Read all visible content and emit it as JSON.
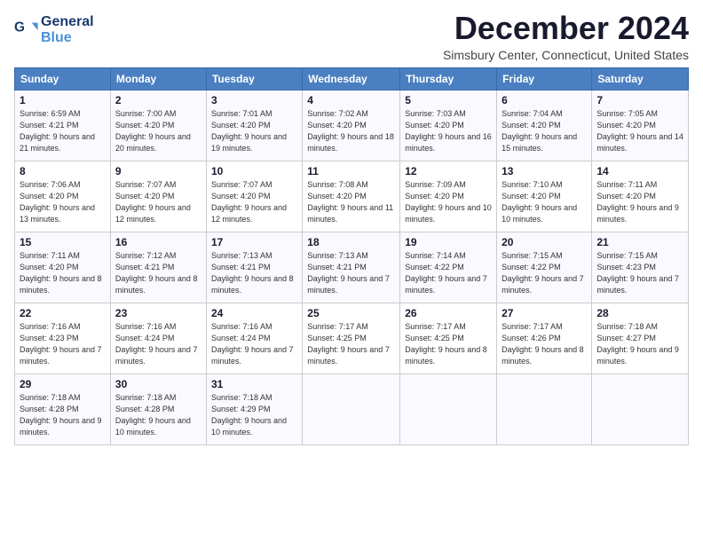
{
  "header": {
    "logo_line1": "General",
    "logo_line2": "Blue",
    "title": "December 2024",
    "subtitle": "Simsbury Center, Connecticut, United States"
  },
  "calendar": {
    "days_of_week": [
      "Sunday",
      "Monday",
      "Tuesday",
      "Wednesday",
      "Thursday",
      "Friday",
      "Saturday"
    ],
    "weeks": [
      [
        {
          "day": "1",
          "sunrise": "6:59 AM",
          "sunset": "4:21 PM",
          "daylight": "9 hours and 21 minutes."
        },
        {
          "day": "2",
          "sunrise": "7:00 AM",
          "sunset": "4:20 PM",
          "daylight": "9 hours and 20 minutes."
        },
        {
          "day": "3",
          "sunrise": "7:01 AM",
          "sunset": "4:20 PM",
          "daylight": "9 hours and 19 minutes."
        },
        {
          "day": "4",
          "sunrise": "7:02 AM",
          "sunset": "4:20 PM",
          "daylight": "9 hours and 18 minutes."
        },
        {
          "day": "5",
          "sunrise": "7:03 AM",
          "sunset": "4:20 PM",
          "daylight": "9 hours and 16 minutes."
        },
        {
          "day": "6",
          "sunrise": "7:04 AM",
          "sunset": "4:20 PM",
          "daylight": "9 hours and 15 minutes."
        },
        {
          "day": "7",
          "sunrise": "7:05 AM",
          "sunset": "4:20 PM",
          "daylight": "9 hours and 14 minutes."
        }
      ],
      [
        {
          "day": "8",
          "sunrise": "7:06 AM",
          "sunset": "4:20 PM",
          "daylight": "9 hours and 13 minutes."
        },
        {
          "day": "9",
          "sunrise": "7:07 AM",
          "sunset": "4:20 PM",
          "daylight": "9 hours and 12 minutes."
        },
        {
          "day": "10",
          "sunrise": "7:07 AM",
          "sunset": "4:20 PM",
          "daylight": "9 hours and 12 minutes."
        },
        {
          "day": "11",
          "sunrise": "7:08 AM",
          "sunset": "4:20 PM",
          "daylight": "9 hours and 11 minutes."
        },
        {
          "day": "12",
          "sunrise": "7:09 AM",
          "sunset": "4:20 PM",
          "daylight": "9 hours and 10 minutes."
        },
        {
          "day": "13",
          "sunrise": "7:10 AM",
          "sunset": "4:20 PM",
          "daylight": "9 hours and 10 minutes."
        },
        {
          "day": "14",
          "sunrise": "7:11 AM",
          "sunset": "4:20 PM",
          "daylight": "9 hours and 9 minutes."
        }
      ],
      [
        {
          "day": "15",
          "sunrise": "7:11 AM",
          "sunset": "4:20 PM",
          "daylight": "9 hours and 8 minutes."
        },
        {
          "day": "16",
          "sunrise": "7:12 AM",
          "sunset": "4:21 PM",
          "daylight": "9 hours and 8 minutes."
        },
        {
          "day": "17",
          "sunrise": "7:13 AM",
          "sunset": "4:21 PM",
          "daylight": "9 hours and 8 minutes."
        },
        {
          "day": "18",
          "sunrise": "7:13 AM",
          "sunset": "4:21 PM",
          "daylight": "9 hours and 7 minutes."
        },
        {
          "day": "19",
          "sunrise": "7:14 AM",
          "sunset": "4:22 PM",
          "daylight": "9 hours and 7 minutes."
        },
        {
          "day": "20",
          "sunrise": "7:15 AM",
          "sunset": "4:22 PM",
          "daylight": "9 hours and 7 minutes."
        },
        {
          "day": "21",
          "sunrise": "7:15 AM",
          "sunset": "4:23 PM",
          "daylight": "9 hours and 7 minutes."
        }
      ],
      [
        {
          "day": "22",
          "sunrise": "7:16 AM",
          "sunset": "4:23 PM",
          "daylight": "9 hours and 7 minutes."
        },
        {
          "day": "23",
          "sunrise": "7:16 AM",
          "sunset": "4:24 PM",
          "daylight": "9 hours and 7 minutes."
        },
        {
          "day": "24",
          "sunrise": "7:16 AM",
          "sunset": "4:24 PM",
          "daylight": "9 hours and 7 minutes."
        },
        {
          "day": "25",
          "sunrise": "7:17 AM",
          "sunset": "4:25 PM",
          "daylight": "9 hours and 7 minutes."
        },
        {
          "day": "26",
          "sunrise": "7:17 AM",
          "sunset": "4:25 PM",
          "daylight": "9 hours and 8 minutes."
        },
        {
          "day": "27",
          "sunrise": "7:17 AM",
          "sunset": "4:26 PM",
          "daylight": "9 hours and 8 minutes."
        },
        {
          "day": "28",
          "sunrise": "7:18 AM",
          "sunset": "4:27 PM",
          "daylight": "9 hours and 9 minutes."
        }
      ],
      [
        {
          "day": "29",
          "sunrise": "7:18 AM",
          "sunset": "4:28 PM",
          "daylight": "9 hours and 9 minutes."
        },
        {
          "day": "30",
          "sunrise": "7:18 AM",
          "sunset": "4:28 PM",
          "daylight": "9 hours and 10 minutes."
        },
        {
          "day": "31",
          "sunrise": "7:18 AM",
          "sunset": "4:29 PM",
          "daylight": "9 hours and 10 minutes."
        },
        null,
        null,
        null,
        null
      ]
    ]
  }
}
